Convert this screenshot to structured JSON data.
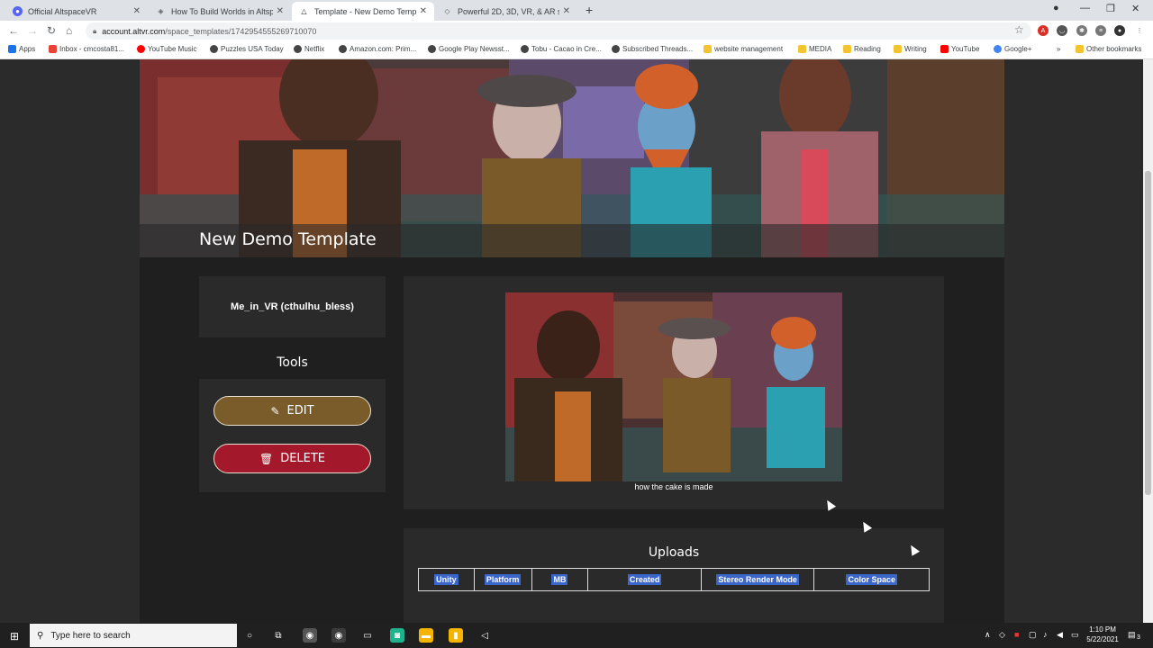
{
  "browser": {
    "tabs": [
      {
        "title": "Official AltspaceVR",
        "icon": "discord-icon",
        "active": false
      },
      {
        "title": "How To Build Worlds in Altspace",
        "icon": "altspace-icon",
        "active": false
      },
      {
        "title": "Template - New Demo Template",
        "icon": "altspace-icon",
        "active": true
      },
      {
        "title": "Powerful 2D, 3D, VR, & AR softw",
        "icon": "unity-icon",
        "active": false
      }
    ],
    "new_tab": "+",
    "address": {
      "domain": "account.altvr.com",
      "path": "/space_templates/1742954555269710070"
    },
    "bookmarks": [
      "Apps",
      "Inbox - cmcosta81...",
      "YouTube Music",
      "Puzzles USA Today",
      "Netflix",
      "Amazon.com: Prim...",
      "Google Play Newsst...",
      "Tobu - Cacao in Cre...",
      "Subscribed Threads...",
      "website management",
      "MEDIA",
      "Reading",
      "Writing",
      "YouTube",
      "Google+"
    ],
    "other_bookmarks": "Other bookmarks",
    "more_bookmarks": "»"
  },
  "template": {
    "title": "New Demo Template",
    "owner": "Me_in_VR (cthulhu_bless)",
    "tools_label": "Tools",
    "edit_label": "EDIT",
    "delete_label": "DELETE",
    "preview_caption": "how the cake is made",
    "uploads_title": "Uploads",
    "uploads_columns": [
      "Unity",
      "Platform",
      "MB",
      "Created",
      "Stereo Render Mode",
      "Color Space"
    ]
  },
  "taskbar": {
    "search_placeholder": "Type here to search",
    "time": "1:10 PM",
    "date": "5/22/2021",
    "notification_count": "3"
  },
  "colors": {
    "edit": "#7a5c2a",
    "delete": "#a3192b",
    "selection": "#3a66c9",
    "page_bg": "#2b2b2b",
    "panel_bg": "#2a2a2a"
  }
}
